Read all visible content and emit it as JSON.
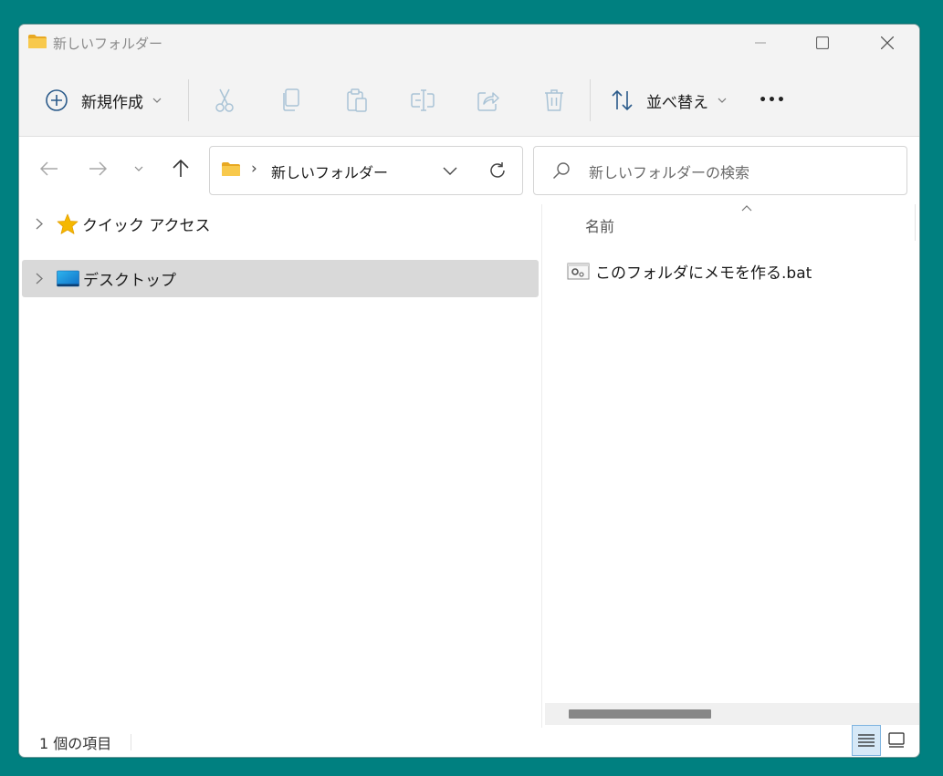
{
  "window": {
    "title": "新しいフォルダー"
  },
  "toolbar": {
    "new_label": "新規作成",
    "sort_label": "並べ替え",
    "more_label": "•••"
  },
  "address": {
    "separator": "›",
    "path": "新しいフォルダー"
  },
  "search": {
    "placeholder": "新しいフォルダーの検索"
  },
  "nav": {
    "items": [
      {
        "label": "クイック アクセス",
        "icon": "star-icon"
      },
      {
        "label": "デスクトップ",
        "icon": "desktop-icon",
        "selected": true
      }
    ]
  },
  "list": {
    "column_name": "名前",
    "sort_indicator": "^",
    "files": [
      {
        "name": "このフォルダにメモを作る.bat",
        "icon": "batch-file-icon"
      }
    ]
  },
  "status": {
    "item_count": "1 個の項目"
  },
  "colors": {
    "desktop_bg": "#008080",
    "folder_yellow": "#f8c94c",
    "star": "#f5b800",
    "selection": "#d9d9d9"
  }
}
